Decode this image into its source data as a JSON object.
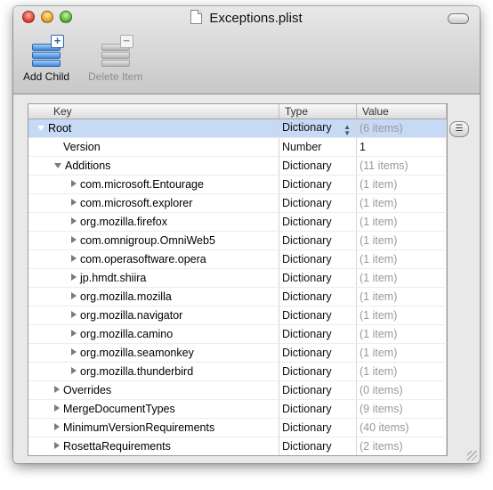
{
  "window": {
    "title": "Exceptions.plist"
  },
  "toolbar": {
    "add_child": "Add Child",
    "delete_item": "Delete Item"
  },
  "columns": {
    "key": "Key",
    "type": "Type",
    "value": "Value"
  },
  "rows": [
    {
      "key": "Root",
      "type": "Dictionary",
      "value": "(6 items)",
      "level": 0,
      "expander": "open",
      "selected": true
    },
    {
      "key": "Version",
      "type": "Number",
      "value": "1",
      "level": 1,
      "expander": "none"
    },
    {
      "key": "Additions",
      "type": "Dictionary",
      "value": "(11 items)",
      "level": 1,
      "expander": "open"
    },
    {
      "key": "com.microsoft.Entourage",
      "type": "Dictionary",
      "value": "(1 item)",
      "level": 2,
      "expander": "closed"
    },
    {
      "key": "com.microsoft.explorer",
      "type": "Dictionary",
      "value": "(1 item)",
      "level": 2,
      "expander": "closed"
    },
    {
      "key": "org.mozilla.firefox",
      "type": "Dictionary",
      "value": "(1 item)",
      "level": 2,
      "expander": "closed"
    },
    {
      "key": "com.omnigroup.OmniWeb5",
      "type": "Dictionary",
      "value": "(1 item)",
      "level": 2,
      "expander": "closed"
    },
    {
      "key": "com.operasoftware.opera",
      "type": "Dictionary",
      "value": "(1 item)",
      "level": 2,
      "expander": "closed"
    },
    {
      "key": "jp.hmdt.shiira",
      "type": "Dictionary",
      "value": "(1 item)",
      "level": 2,
      "expander": "closed"
    },
    {
      "key": "org.mozilla.mozilla",
      "type": "Dictionary",
      "value": "(1 item)",
      "level": 2,
      "expander": "closed"
    },
    {
      "key": "org.mozilla.navigator",
      "type": "Dictionary",
      "value": "(1 item)",
      "level": 2,
      "expander": "closed"
    },
    {
      "key": "org.mozilla.camino",
      "type": "Dictionary",
      "value": "(1 item)",
      "level": 2,
      "expander": "closed"
    },
    {
      "key": "org.mozilla.seamonkey",
      "type": "Dictionary",
      "value": "(1 item)",
      "level": 2,
      "expander": "closed"
    },
    {
      "key": "org.mozilla.thunderbird",
      "type": "Dictionary",
      "value": "(1 item)",
      "level": 2,
      "expander": "closed"
    },
    {
      "key": "Overrides",
      "type": "Dictionary",
      "value": "(0 items)",
      "level": 1,
      "expander": "closed"
    },
    {
      "key": "MergeDocumentTypes",
      "type": "Dictionary",
      "value": "(9 items)",
      "level": 1,
      "expander": "closed"
    },
    {
      "key": "MinimumVersionRequirements",
      "type": "Dictionary",
      "value": "(40 items)",
      "level": 1,
      "expander": "closed"
    },
    {
      "key": "RosettaRequirements",
      "type": "Dictionary",
      "value": "(2 items)",
      "level": 1,
      "expander": "closed"
    }
  ],
  "colors": {
    "selection": "#c6d9f5",
    "muted_value": "#999999"
  }
}
